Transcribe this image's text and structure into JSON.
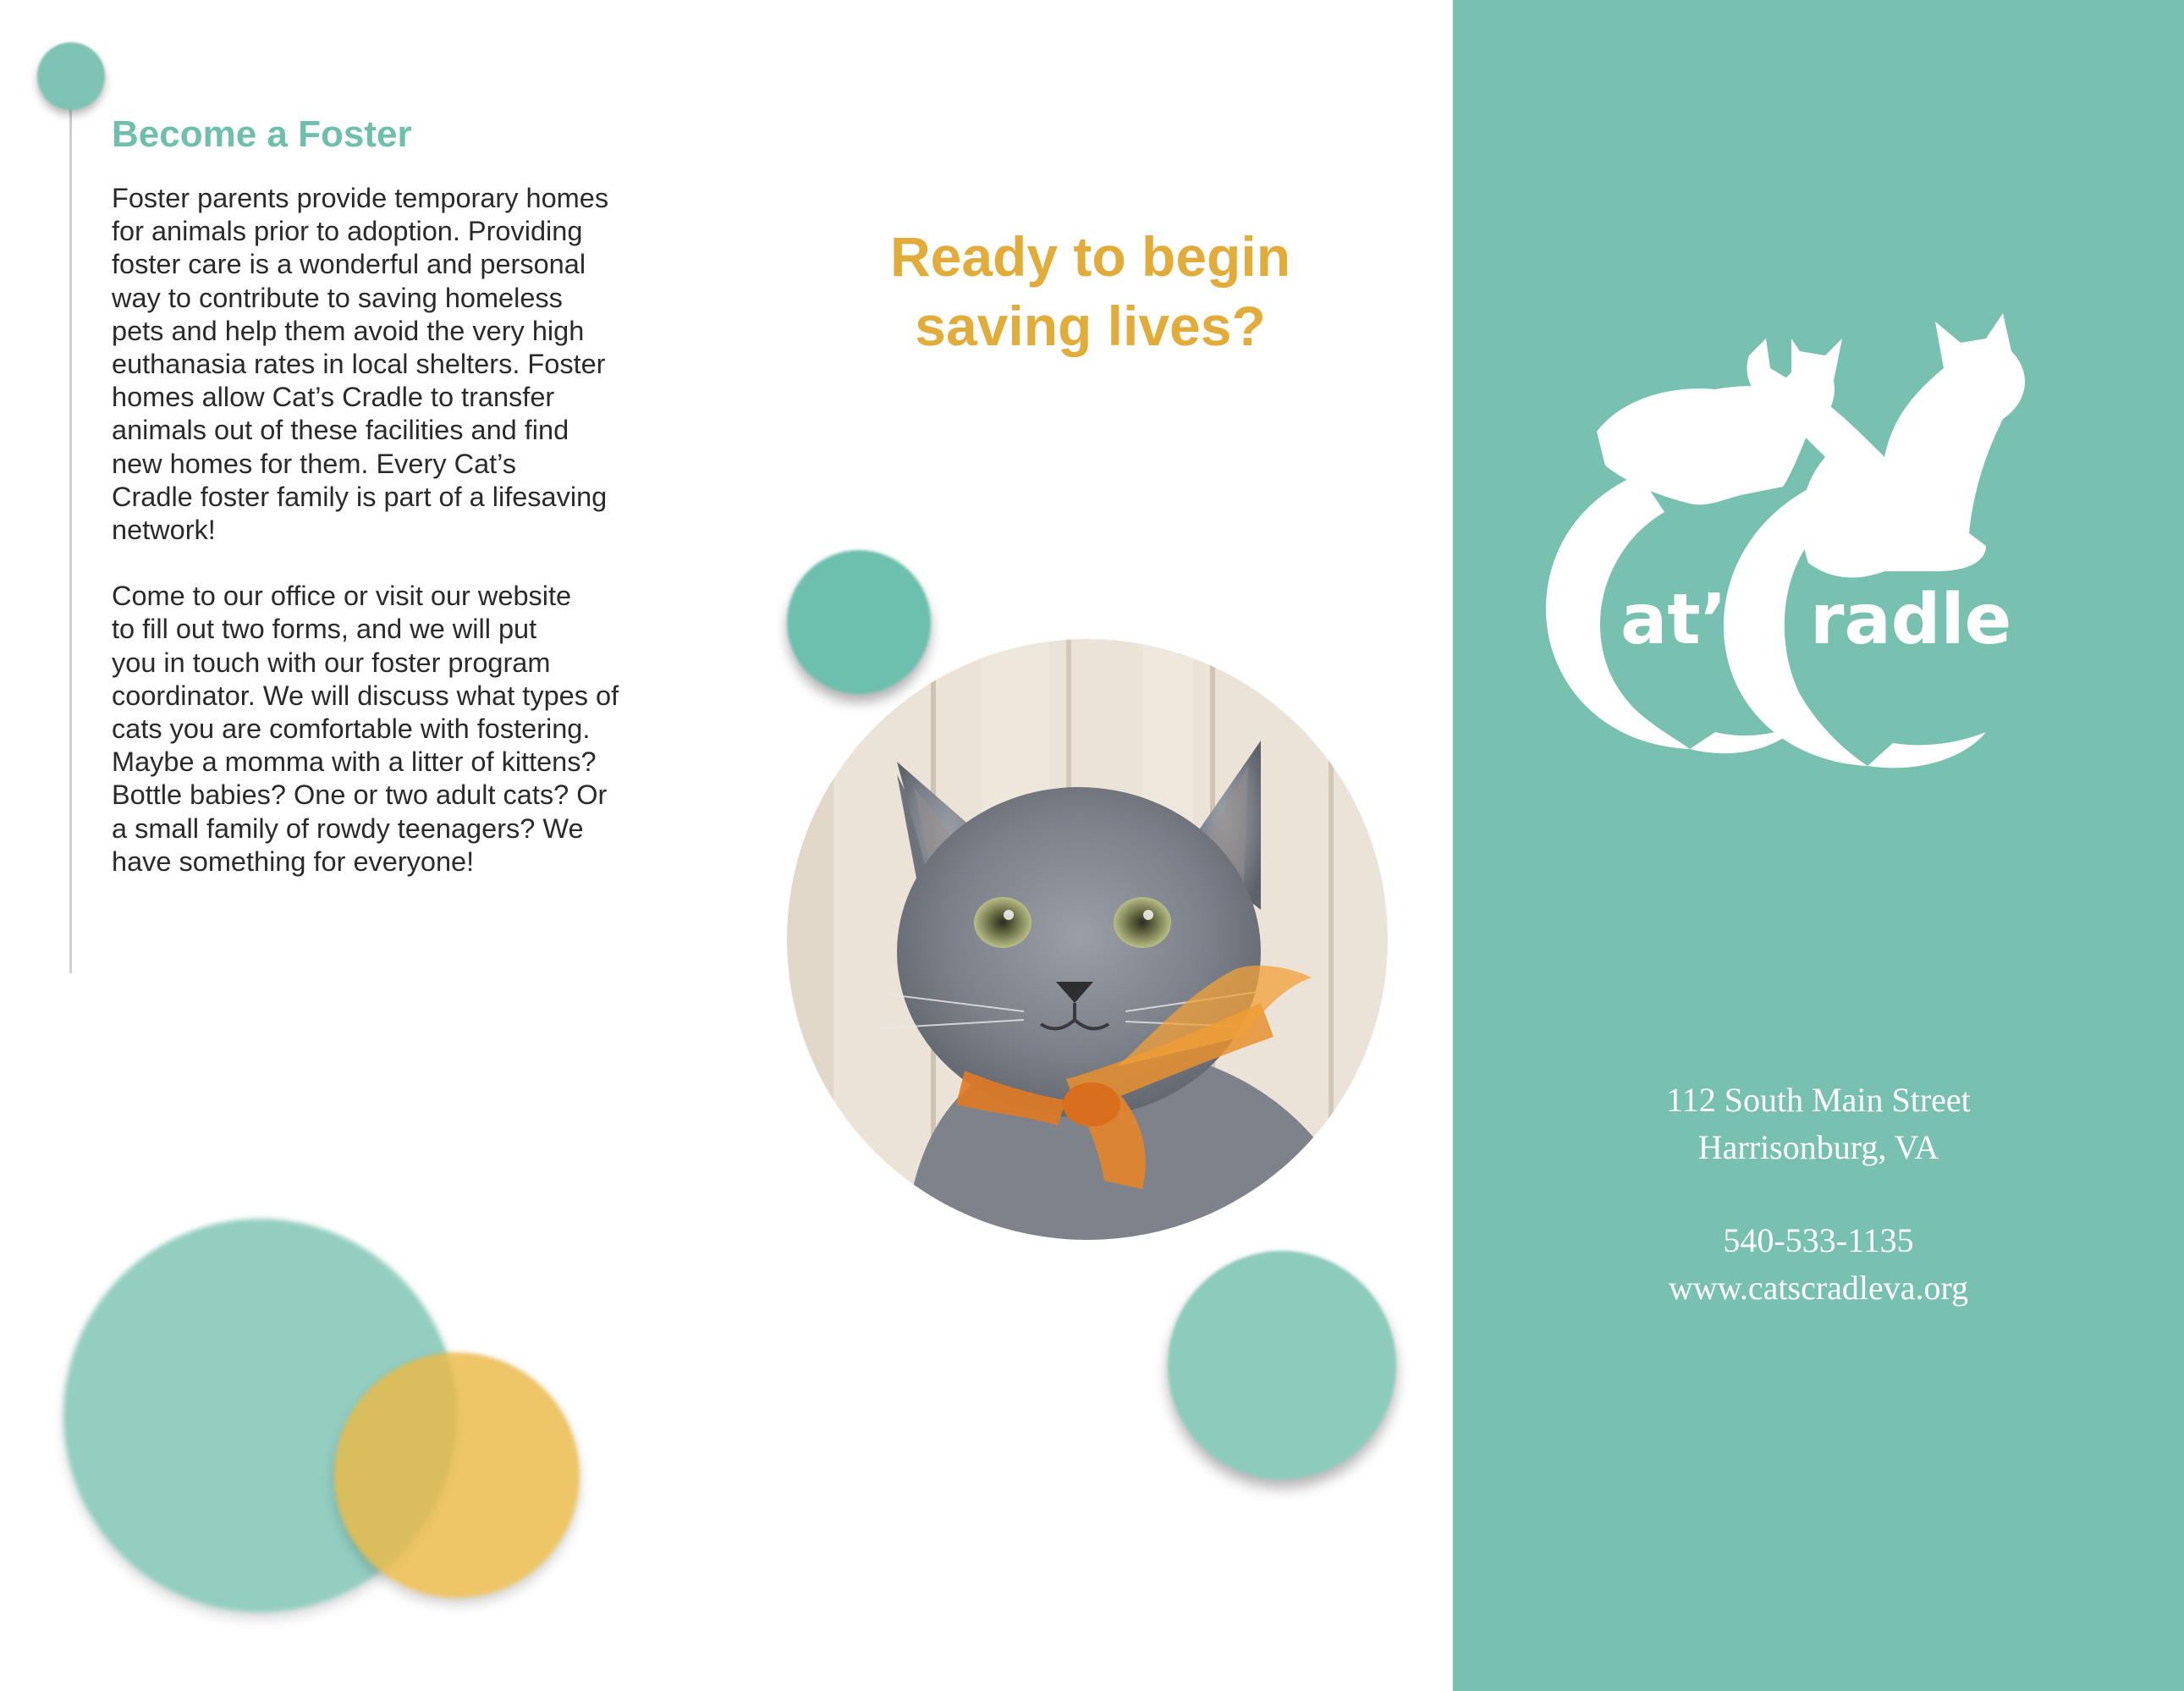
{
  "left_panel": {
    "heading": "Become a Foster",
    "paragraphs": [
      "Foster parents provide temporary homes\nfor animals prior to adoption.  Providing\nfoster care is a wonderful and personal\nway to contribute to saving homeless\npets and help them avoid the very high\neuthanasia rates in local shelters. Foster\nhomes allow Cat’s Cradle to transfer\nanimals out of these facilities and find\nnew homes for them.  Every Cat’s\nCradle foster family is part of a lifesaving\nnetwork!",
      "Come to our office or visit our website\nto fill out two forms, and we will put\nyou in touch with our foster program\ncoordinator. We will discuss what types of\ncats you are comfortable with fostering.\nMaybe a momma with a litter of kittens?\nBottle babies?  One or two adult cats?  Or\na small family of rowdy teenagers?  We\nhave something for everyone!"
    ]
  },
  "center_panel": {
    "heading": "Ready to begin\nsaving lives?",
    "photo_subject": "gray-kitten-with-orange-ribbon"
  },
  "right_panel": {
    "logo": {
      "text_left": "at’s",
      "text_right": "radle",
      "initial": "C",
      "full_name": "Cat’s Cradle"
    },
    "address_line1": "112 South Main Street",
    "address_line2": "Harrisonburg, VA",
    "phone": "540-533-1135",
    "website": "www.catscradleva.org"
  },
  "colors": {
    "teal": "#78c1b1",
    "heading_teal": "#6fbfad",
    "gold": "#e2ac3b",
    "text": "#2a2a2a"
  }
}
